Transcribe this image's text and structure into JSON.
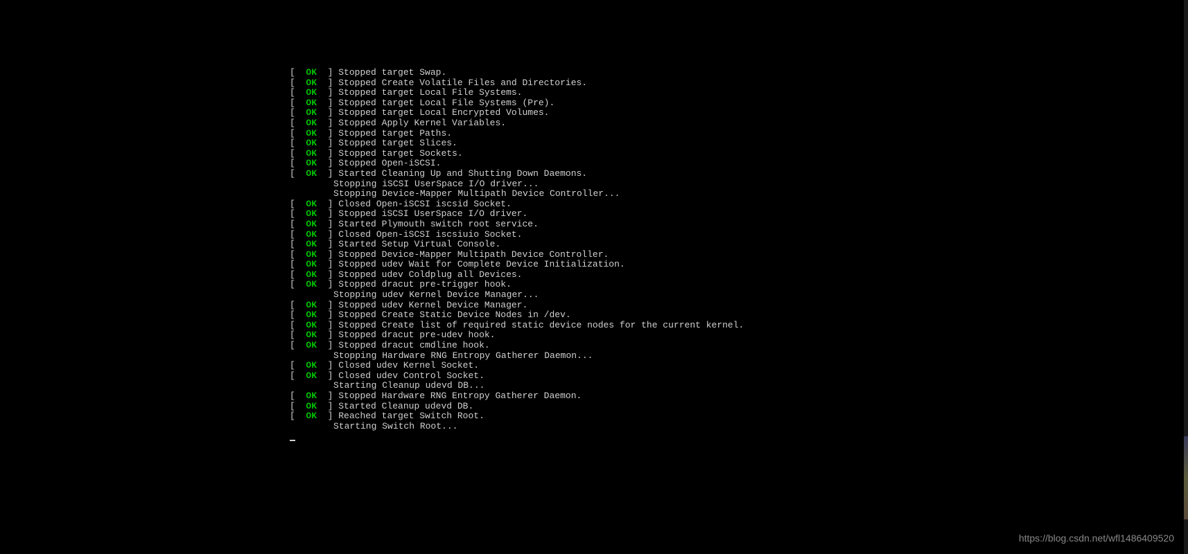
{
  "bracket_open": "[  ",
  "bracket_close": "  ] ",
  "status_ok": "OK",
  "lines": [
    {
      "status": true,
      "message": "Stopped target Swap."
    },
    {
      "status": true,
      "message": "Stopped Create Volatile Files and Directories."
    },
    {
      "status": true,
      "message": "Stopped target Local File Systems."
    },
    {
      "status": true,
      "message": "Stopped target Local File Systems (Pre)."
    },
    {
      "status": true,
      "message": "Stopped target Local Encrypted Volumes."
    },
    {
      "status": true,
      "message": "Stopped Apply Kernel Variables."
    },
    {
      "status": true,
      "message": "Stopped target Paths."
    },
    {
      "status": true,
      "message": "Stopped target Slices."
    },
    {
      "status": true,
      "message": "Stopped target Sockets."
    },
    {
      "status": true,
      "message": "Stopped Open-iSCSI."
    },
    {
      "status": true,
      "message": "Started Cleaning Up and Shutting Down Daemons."
    },
    {
      "status": false,
      "message": "Stopping iSCSI UserSpace I/O driver..."
    },
    {
      "status": false,
      "message": "Stopping Device-Mapper Multipath Device Controller..."
    },
    {
      "status": true,
      "message": "Closed Open-iSCSI iscsid Socket."
    },
    {
      "status": true,
      "message": "Stopped iSCSI UserSpace I/O driver."
    },
    {
      "status": true,
      "message": "Started Plymouth switch root service."
    },
    {
      "status": true,
      "message": "Closed Open-iSCSI iscsiuio Socket."
    },
    {
      "status": true,
      "message": "Started Setup Virtual Console."
    },
    {
      "status": true,
      "message": "Stopped Device-Mapper Multipath Device Controller."
    },
    {
      "status": true,
      "message": "Stopped udev Wait for Complete Device Initialization."
    },
    {
      "status": true,
      "message": "Stopped udev Coldplug all Devices."
    },
    {
      "status": true,
      "message": "Stopped dracut pre-trigger hook."
    },
    {
      "status": false,
      "message": "Stopping udev Kernel Device Manager..."
    },
    {
      "status": true,
      "message": "Stopped udev Kernel Device Manager."
    },
    {
      "status": true,
      "message": "Stopped Create Static Device Nodes in /dev."
    },
    {
      "status": true,
      "message": "Stopped Create list of required static device nodes for the current kernel."
    },
    {
      "status": true,
      "message": "Stopped dracut pre-udev hook."
    },
    {
      "status": true,
      "message": "Stopped dracut cmdline hook."
    },
    {
      "status": false,
      "message": "Stopping Hardware RNG Entropy Gatherer Daemon..."
    },
    {
      "status": true,
      "message": "Closed udev Kernel Socket."
    },
    {
      "status": true,
      "message": "Closed udev Control Socket."
    },
    {
      "status": false,
      "message": "Starting Cleanup udevd DB..."
    },
    {
      "status": true,
      "message": "Stopped Hardware RNG Entropy Gatherer Daemon."
    },
    {
      "status": true,
      "message": "Started Cleanup udevd DB."
    },
    {
      "status": true,
      "message": "Reached target Switch Root."
    },
    {
      "status": false,
      "message": "Starting Switch Root..."
    }
  ],
  "watermark": "https://blog.csdn.net/wfl1486409520"
}
